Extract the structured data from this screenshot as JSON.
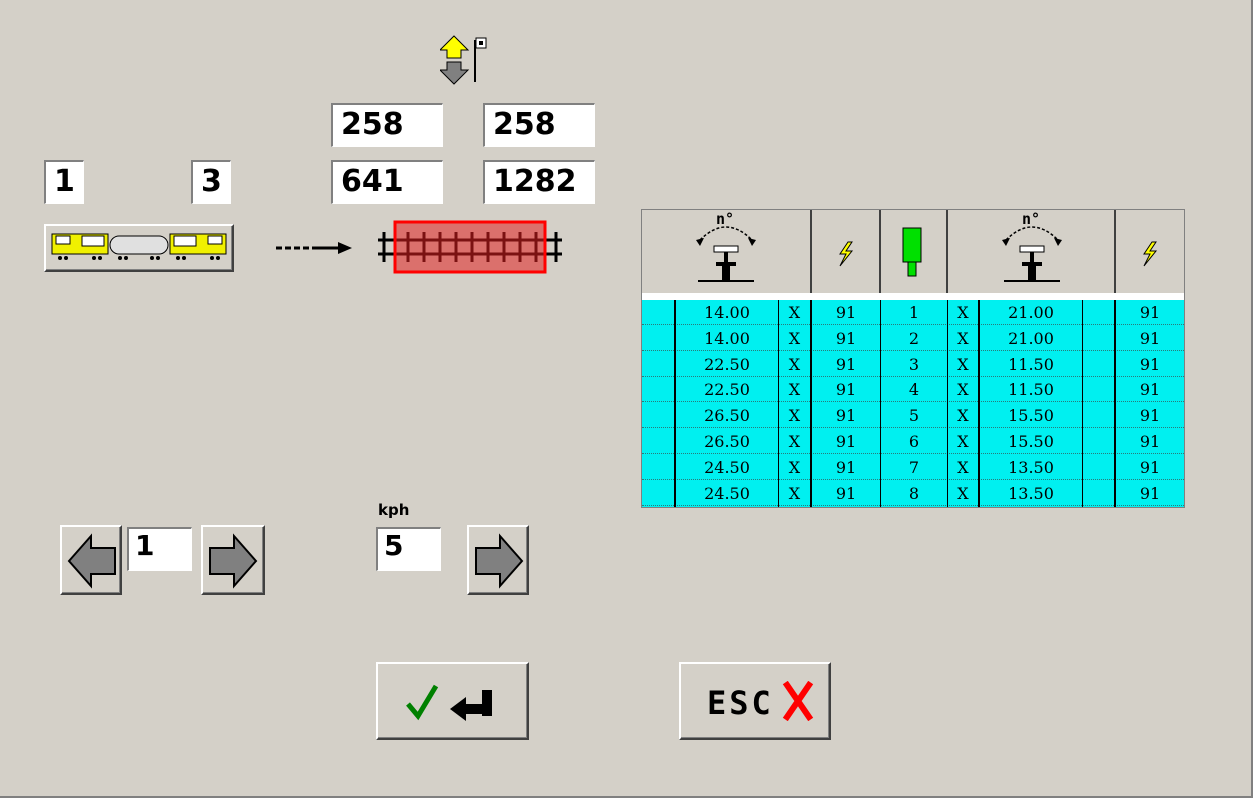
{
  "header": {
    "direction_icon": "up-down-arrow-with-signal-icon"
  },
  "counts": {
    "left_value": "1",
    "right_value": "3",
    "top_a": "258",
    "top_b": "258",
    "bottom_a": "641",
    "bottom_b": "1282"
  },
  "stepper": {
    "value": "1"
  },
  "speed": {
    "unit_label": "kph",
    "value": "5"
  },
  "table": {
    "header_icons": [
      "rail-rotation-icon",
      "lightning-icon",
      "green-marker-icon",
      "rail-rotation-icon",
      "lightning-icon"
    ],
    "header_labels": [
      "n°",
      "n°"
    ],
    "rows": [
      {
        "a": "14.00",
        "x1": "X",
        "b": "91",
        "n": "1",
        "x2": "X",
        "c": "21.00",
        "d": "91"
      },
      {
        "a": "14.00",
        "x1": "X",
        "b": "91",
        "n": "2",
        "x2": "X",
        "c": "21.00",
        "d": "91"
      },
      {
        "a": "22.50",
        "x1": "X",
        "b": "91",
        "n": "3",
        "x2": "X",
        "c": "11.50",
        "d": "91"
      },
      {
        "a": "22.50",
        "x1": "X",
        "b": "91",
        "n": "4",
        "x2": "X",
        "c": "11.50",
        "d": "91"
      },
      {
        "a": "26.50",
        "x1": "X",
        "b": "91",
        "n": "5",
        "x2": "X",
        "c": "15.50",
        "d": "91"
      },
      {
        "a": "26.50",
        "x1": "X",
        "b": "91",
        "n": "6",
        "x2": "X",
        "c": "15.50",
        "d": "91"
      },
      {
        "a": "24.50",
        "x1": "X",
        "b": "91",
        "n": "7",
        "x2": "X",
        "c": "13.50",
        "d": "91"
      },
      {
        "a": "24.50",
        "x1": "X",
        "b": "91",
        "n": "8",
        "x2": "X",
        "c": "13.50",
        "d": "91"
      }
    ]
  },
  "buttons": {
    "esc_label": "ESC"
  },
  "colors": {
    "table_body": "#00f0f0",
    "window_bg": "#d4d0c8",
    "track_highlight": "#e02020",
    "car_yellow": "#f0f000"
  }
}
